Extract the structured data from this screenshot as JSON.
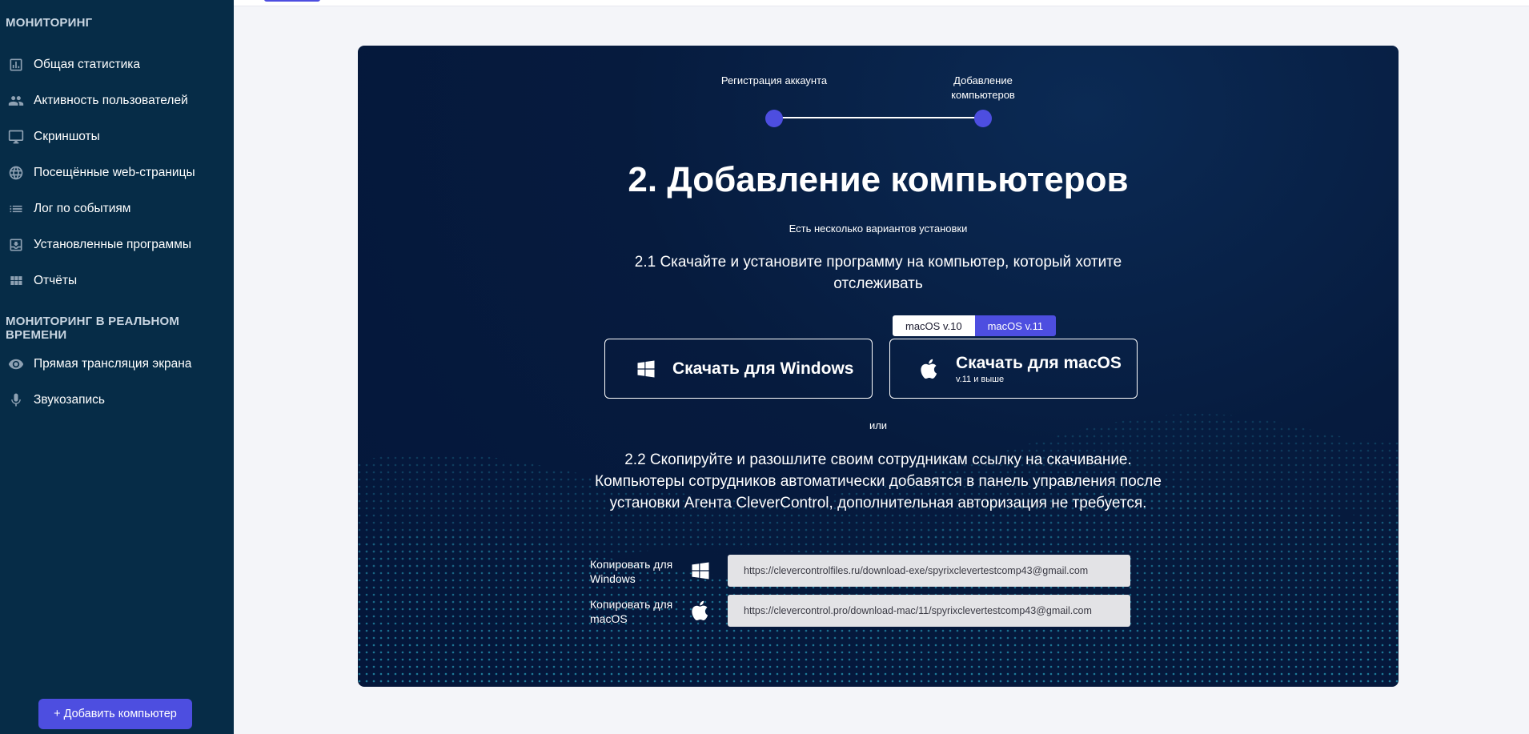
{
  "sidebar": {
    "section_monitoring": "МОНИТОРИНГ",
    "section_realtime": "МОНИТОРИНГ В РЕАЛЬНОМ ВРЕМЕНИ",
    "items": [
      {
        "label": "Общая статистика",
        "icon": "bar-chart-icon"
      },
      {
        "label": "Активность пользователей",
        "icon": "users-icon"
      },
      {
        "label": "Скриншоты",
        "icon": "monitor-icon"
      },
      {
        "label": "Посещённые web-страницы",
        "icon": "globe-icon"
      },
      {
        "label": "Лог по событиям",
        "icon": "list-icon"
      },
      {
        "label": "Установленные программы",
        "icon": "install-icon"
      },
      {
        "label": "Отчёты",
        "icon": "grid-icon"
      }
    ],
    "realtime_items": [
      {
        "label": "Прямая трансляция экрана",
        "icon": "eye-icon"
      },
      {
        "label": "Звукозапись",
        "icon": "microphone-icon"
      }
    ],
    "add_button": "+ Добавить компьютер"
  },
  "wizard": {
    "steps": [
      "Регистрация аккаунта",
      "Добавление компьютеров"
    ],
    "title": "2. Добавление компьютеров",
    "subtitle": "Есть несколько вариантов установки",
    "step1_text": "2.1 Скачайте и установите программу на компьютер, который хотите отслеживать",
    "os_toggle": {
      "option_a": "macOS v.10",
      "option_b": "macOS v.11",
      "selected": "macOS v.11"
    },
    "download_windows": "Скачать для Windows",
    "download_mac": "Скачать для macOS",
    "download_mac_sub": "v.11 и выше",
    "or_text": "или",
    "step2_text": "2.2 Скопируйте и разошлите своим сотрудникам ссылку на скачивание. Компьютеры сотрудников автоматически добавятся в панель управления после установки Агента CleverControl, дополнительная авторизация не требуется.",
    "copy_windows_label": "Копировать для Windows",
    "copy_windows_url": "https://clevercontrolfiles.ru/download-exe/spyrixclevertestcomp43@gmail.com",
    "copy_mac_label": "Копировать для macOS",
    "copy_mac_url": "https://clevercontrol.pro/download-mac/11/spyrixclevertestcomp43@gmail.com"
  },
  "colors": {
    "sidebar_bg": "#062c47",
    "accent": "#4d4ee0",
    "card_bg": "#061b3e",
    "page_bg": "#f4f5f9"
  }
}
